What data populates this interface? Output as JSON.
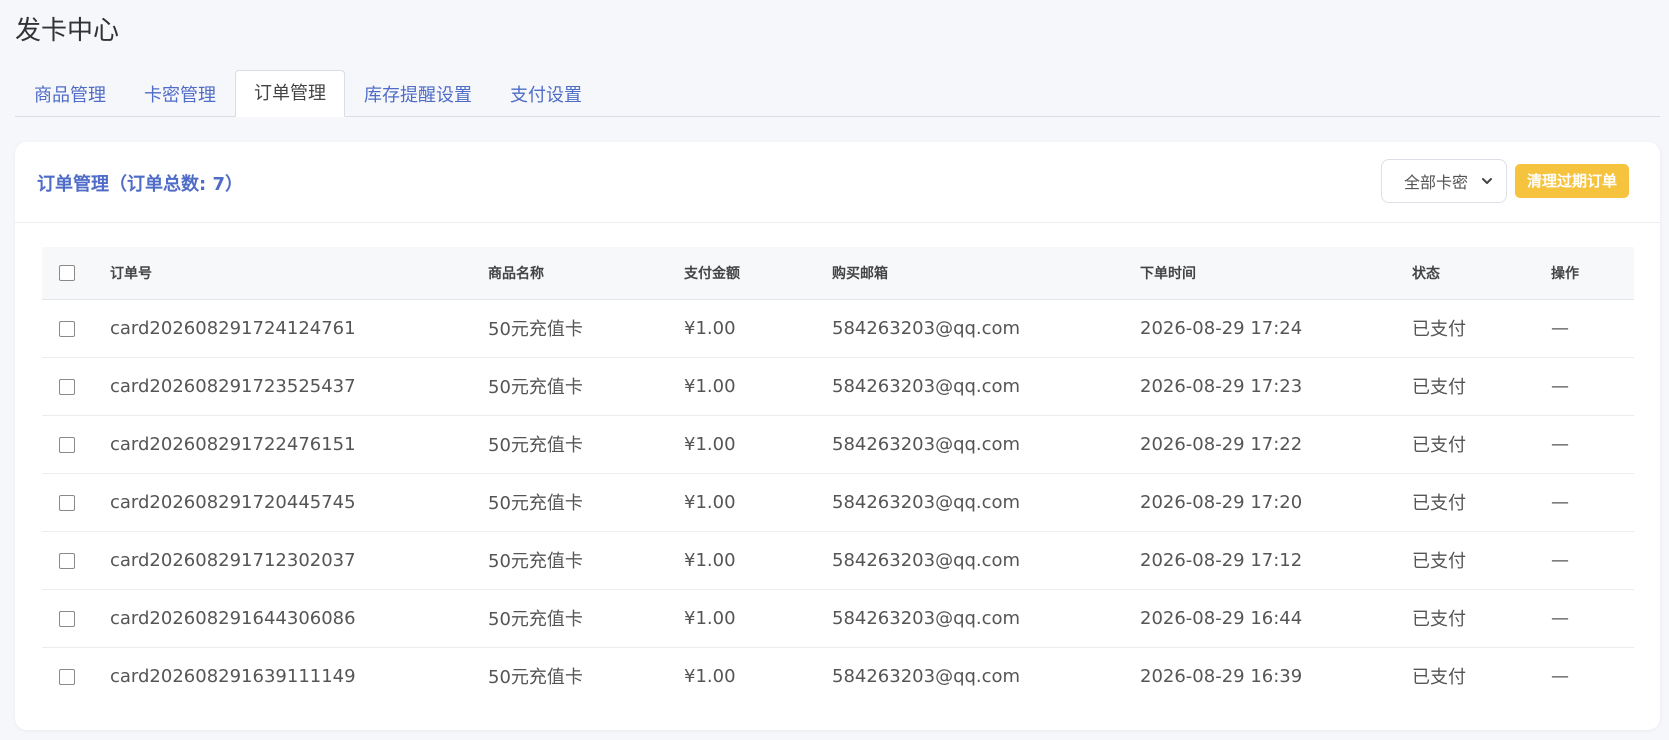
{
  "page_title": "发卡中心",
  "tabs": [
    {
      "label": "商品管理",
      "active": false
    },
    {
      "label": "卡密管理",
      "active": false
    },
    {
      "label": "订单管理",
      "active": true
    },
    {
      "label": "库存提醒设置",
      "active": false
    },
    {
      "label": "支付设置",
      "active": false
    }
  ],
  "card": {
    "title": "订单管理（订单总数: 7）",
    "filter_value": "全部卡密",
    "clear_button": "清理过期订单"
  },
  "table": {
    "columns": [
      "订单号",
      "商品名称",
      "支付金额",
      "购买邮箱",
      "下单时间",
      "状态",
      "操作"
    ],
    "rows": [
      {
        "order_no": "card202608291724124761",
        "product": "50元充值卡",
        "amount": "¥1.00",
        "email": "584263203@qq.com",
        "time": "2026-08-29 17:24",
        "status": "已支付",
        "action": "—"
      },
      {
        "order_no": "card202608291723525437",
        "product": "50元充值卡",
        "amount": "¥1.00",
        "email": "584263203@qq.com",
        "time": "2026-08-29 17:23",
        "status": "已支付",
        "action": "—"
      },
      {
        "order_no": "card202608291722476151",
        "product": "50元充值卡",
        "amount": "¥1.00",
        "email": "584263203@qq.com",
        "time": "2026-08-29 17:22",
        "status": "已支付",
        "action": "—"
      },
      {
        "order_no": "card202608291720445745",
        "product": "50元充值卡",
        "amount": "¥1.00",
        "email": "584263203@qq.com",
        "time": "2026-08-29 17:20",
        "status": "已支付",
        "action": "—"
      },
      {
        "order_no": "card202608291712302037",
        "product": "50元充值卡",
        "amount": "¥1.00",
        "email": "584263203@qq.com",
        "time": "2026-08-29 17:12",
        "status": "已支付",
        "action": "—"
      },
      {
        "order_no": "card202608291644306086",
        "product": "50元充值卡",
        "amount": "¥1.00",
        "email": "584263203@qq.com",
        "time": "2026-08-29 16:44",
        "status": "已支付",
        "action": "—"
      },
      {
        "order_no": "card202608291639111149",
        "product": "50元充值卡",
        "amount": "¥1.00",
        "email": "584263203@qq.com",
        "time": "2026-08-29 16:39",
        "status": "已支付",
        "action": "—"
      }
    ]
  },
  "colors": {
    "accent": "#4f6cc7",
    "paid": "#22b573",
    "warning_button": "#f6c33e"
  }
}
